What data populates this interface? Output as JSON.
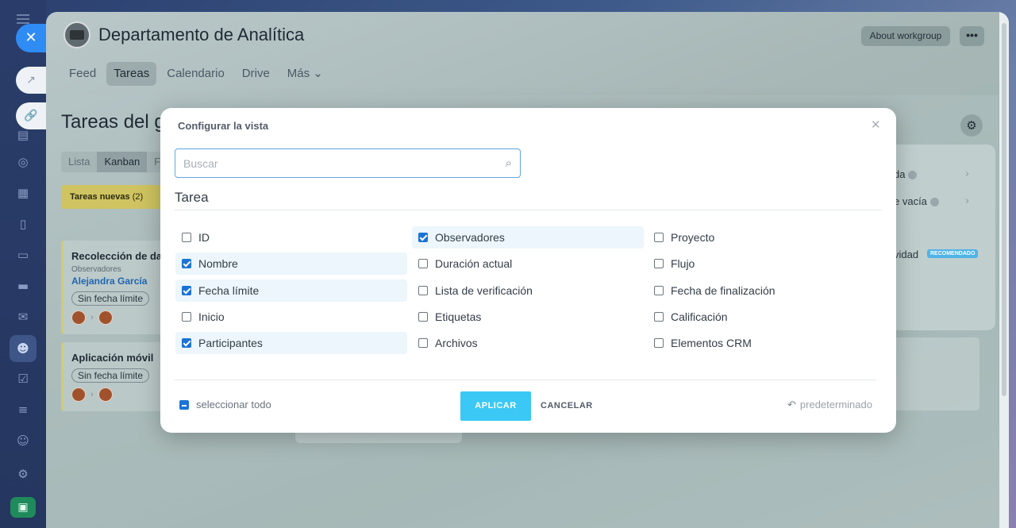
{
  "sidebar": {
    "icons": [
      "menu-icon",
      "close-icon",
      "external-link-icon",
      "link-icon",
      "chat-icon",
      "document-icon",
      "circle-icon",
      "calendar-icon",
      "document-icon",
      "presentation-icon",
      "storage-icon",
      "mail-icon",
      "group-icon",
      "checkbox-icon",
      "filter-icon",
      "robot-icon",
      "gear-icon",
      "app-icon"
    ]
  },
  "header": {
    "title": "Departamento de Analítica",
    "about_label": "About workgroup",
    "more_label": "•••",
    "tabs": [
      {
        "label": "Feed"
      },
      {
        "label": "Tareas"
      },
      {
        "label": "Calendario"
      },
      {
        "label": "Drive"
      },
      {
        "label": "Más ⌄"
      }
    ]
  },
  "content": {
    "page_title": "Tareas del gr",
    "view_tabs": [
      "Lista",
      "Kanban",
      "Fe"
    ],
    "column_title": "Tareas nuevas",
    "column_count": "(2)",
    "cards": [
      {
        "title": "Recolección de dat",
        "small": "Observadores",
        "link": "Alejandra García",
        "badge": "Sin fecha límite"
      },
      {
        "title": "Aplicación móvil",
        "badge": "Sin fecha límite"
      }
    ],
    "popover": {
      "row1": "da",
      "row2": "e vacía",
      "row3": "vidad",
      "badge": "RECOMENDADO"
    }
  },
  "modal": {
    "title": "Configurar la vista",
    "search_placeholder": "Buscar",
    "section": "Tarea",
    "fields": [
      {
        "label": "ID",
        "checked": false
      },
      {
        "label": "Nombre",
        "checked": true
      },
      {
        "label": "Fecha límite",
        "checked": true
      },
      {
        "label": "Inicio",
        "checked": false
      },
      {
        "label": "Participantes",
        "checked": true
      },
      {
        "label": "Observadores",
        "checked": true
      },
      {
        "label": "Duración actual",
        "checked": false
      },
      {
        "label": "Lista de verificación",
        "checked": false
      },
      {
        "label": "Etiquetas",
        "checked": false
      },
      {
        "label": "Archivos",
        "checked": false
      },
      {
        "label": "Proyecto",
        "checked": false
      },
      {
        "label": "Flujo",
        "checked": false
      },
      {
        "label": "Fecha de finalización",
        "checked": false
      },
      {
        "label": "Calificación",
        "checked": false
      },
      {
        "label": "Elementos CRM",
        "checked": false
      }
    ],
    "select_all": "seleccionar todo",
    "apply": "APLICAR",
    "cancel": "CANCELAR",
    "default": "predeterminado"
  }
}
